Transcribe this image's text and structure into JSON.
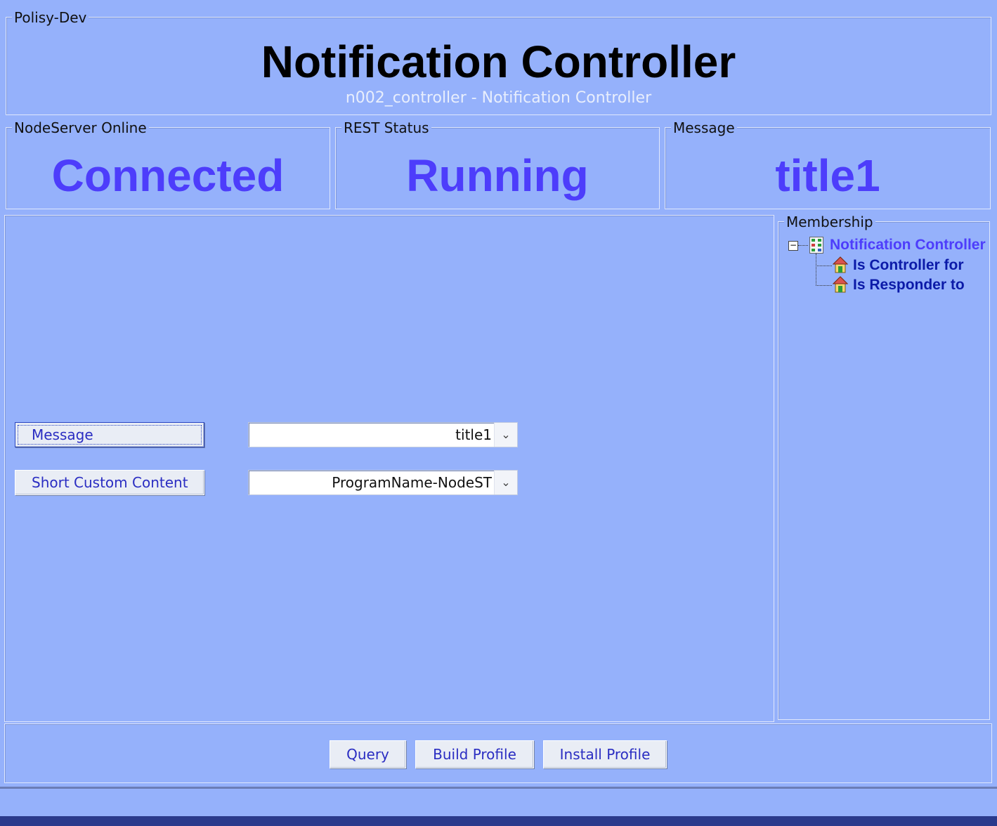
{
  "window": {
    "group_label": "Polisy-Dev",
    "title": "Notification Controller",
    "subtitle": "n002_controller - Notification Controller"
  },
  "status": {
    "online": {
      "label": "NodeServer Online",
      "value": "Connected"
    },
    "rest": {
      "label": "REST Status",
      "value": "Running"
    },
    "message": {
      "label": "Message",
      "value": "title1"
    }
  },
  "controls": {
    "message": {
      "button_label": "Message",
      "selected": "title1"
    },
    "short_custom_content": {
      "button_label": "Short Custom Content",
      "selected": "ProgramName-NodeST"
    }
  },
  "membership": {
    "label": "Membership",
    "root": "Notification Controller",
    "children": [
      "Is Controller for",
      "Is Responder to"
    ]
  },
  "footer": {
    "query_label": "Query",
    "build_profile_label": "Build Profile",
    "install_profile_label": "Install Profile"
  },
  "colors": {
    "background": "#95b1fb",
    "status_value": "#4d3dfb",
    "tree_root": "#4d3dfb",
    "tree_child": "#0b1aa8"
  }
}
